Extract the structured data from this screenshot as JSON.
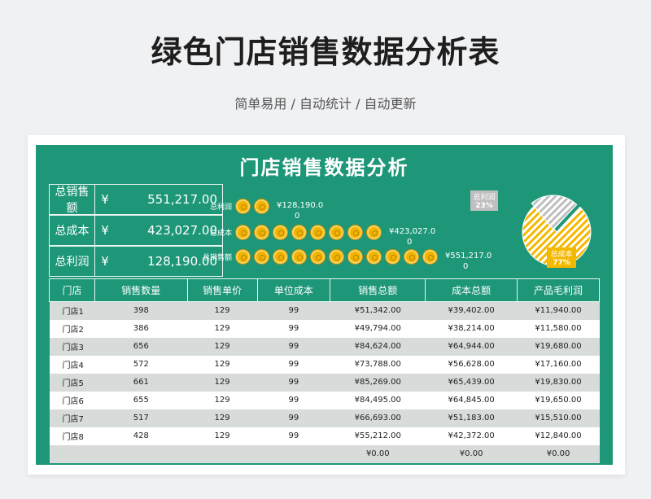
{
  "page": {
    "title": "绿色门店销售数据分析表",
    "subtitle": "简单易用 / 自动统计 / 自动更新"
  },
  "sheet": {
    "title": "门店销售数据分析",
    "kpis": [
      {
        "label": "总销售额",
        "currency": "¥",
        "value": "551,217.00"
      },
      {
        "label": "总成本",
        "currency": "¥",
        "value": "423,027.00"
      },
      {
        "label": "总利润",
        "currency": "¥",
        "value": "128,190.00"
      }
    ],
    "pictograph": [
      {
        "label": "总利润",
        "coins": 2,
        "value_line1": "¥128,190.0",
        "value_line2": "0"
      },
      {
        "label": "总成本",
        "coins": 8,
        "value_line1": "¥423,027.0",
        "value_line2": "0"
      },
      {
        "label": "总销售额",
        "coins": 11,
        "value_line1": "¥551,217.0",
        "value_line2": "0"
      }
    ],
    "pie": {
      "slices": [
        {
          "label": "总利润",
          "percent": "23%",
          "share": 0.23,
          "color": "#bfbfbf"
        },
        {
          "label": "总成本",
          "percent": "77%",
          "share": 0.77,
          "color": "#f5b800"
        }
      ]
    },
    "table": {
      "headers": [
        "门店",
        "销售数量",
        "销售单价",
        "单位成本",
        "销售总额",
        "成本总额",
        "产品毛利润"
      ],
      "rows": [
        [
          "门店1",
          "398",
          "129",
          "99",
          "¥51,342.00",
          "¥39,402.00",
          "¥11,940.00"
        ],
        [
          "门店2",
          "386",
          "129",
          "99",
          "¥49,794.00",
          "¥38,214.00",
          "¥11,580.00"
        ],
        [
          "门店3",
          "656",
          "129",
          "99",
          "¥84,624.00",
          "¥64,944.00",
          "¥19,680.00"
        ],
        [
          "门店4",
          "572",
          "129",
          "99",
          "¥73,788.00",
          "¥56,628.00",
          "¥17,160.00"
        ],
        [
          "门店5",
          "661",
          "129",
          "99",
          "¥85,269.00",
          "¥65,439.00",
          "¥19,830.00"
        ],
        [
          "门店6",
          "655",
          "129",
          "99",
          "¥84,495.00",
          "¥64,845.00",
          "¥19,650.00"
        ],
        [
          "门店7",
          "517",
          "129",
          "99",
          "¥66,693.00",
          "¥51,183.00",
          "¥15,510.00"
        ],
        [
          "门店8",
          "428",
          "129",
          "99",
          "¥55,212.00",
          "¥42,372.00",
          "¥12,840.00"
        ],
        [
          "",
          "",
          "",
          "",
          "¥0.00",
          "¥0.00",
          "¥0.00"
        ]
      ]
    }
  },
  "colors": {
    "sheet_green": "#1e9779",
    "accent_gold": "#f5b800",
    "gray": "#bfbfbf"
  }
}
